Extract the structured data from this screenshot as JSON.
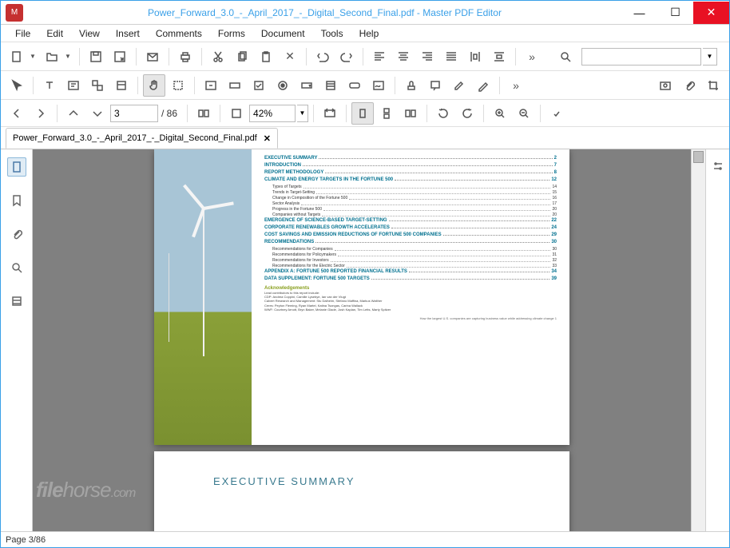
{
  "titlebar": {
    "title": "Power_Forward_3.0_-_April_2017_-_Digital_Second_Final.pdf - Master PDF Editor"
  },
  "menu": {
    "file": "File",
    "edit": "Edit",
    "view": "View",
    "insert": "Insert",
    "comments": "Comments",
    "forms": "Forms",
    "document": "Document",
    "tools": "Tools",
    "help": "Help"
  },
  "nav": {
    "current_page": "3",
    "total_pages": "/ 86",
    "zoom": "42%"
  },
  "tab": {
    "label": "Power_Forward_3.0_-_April_2017_-_Digital_Second_Final.pdf"
  },
  "search": {
    "placeholder": ""
  },
  "toc": [
    {
      "t": "h",
      "label": "EXECUTIVE SUMMARY",
      "pg": "2"
    },
    {
      "t": "h",
      "label": "INTRODUCTION",
      "pg": "7"
    },
    {
      "t": "h",
      "label": "REPORT METHODOLOGY",
      "pg": "8"
    },
    {
      "t": "h",
      "label": "CLIMATE AND ENERGY TARGETS IN THE FORTUNE 500",
      "pg": "12"
    },
    {
      "t": "s",
      "label": "Types of Targets",
      "pg": "14"
    },
    {
      "t": "s",
      "label": "Trends in Target-Setting",
      "pg": "15"
    },
    {
      "t": "s",
      "label": "Change in Composition of the Fortune 500",
      "pg": "16"
    },
    {
      "t": "s",
      "label": "Sector Analysis",
      "pg": "17"
    },
    {
      "t": "s",
      "label": "Progress in the Fortune 500",
      "pg": "20"
    },
    {
      "t": "s",
      "label": "Companies without Targets",
      "pg": "20"
    },
    {
      "t": "h",
      "label": "EMERGENCE OF SCIENCE-BASED TARGET-SETTING",
      "pg": "22"
    },
    {
      "t": "h",
      "label": "CORPORATE RENEWABLES GROWTH ACCELERATES",
      "pg": "24"
    },
    {
      "t": "h",
      "label": "COST SAVINGS AND EMISSION REDUCTIONS OF FORTUNE 500 COMPANIES",
      "pg": "29"
    },
    {
      "t": "h",
      "label": "RECOMMENDATIONS",
      "pg": "30"
    },
    {
      "t": "s",
      "label": "Recommendations for Companies",
      "pg": "30"
    },
    {
      "t": "s",
      "label": "Recommendations for Policymakers",
      "pg": "31"
    },
    {
      "t": "s",
      "label": "Recommendations for Investors",
      "pg": "32"
    },
    {
      "t": "s",
      "label": "Recommendations for the Electric Sector",
      "pg": "33"
    },
    {
      "t": "h",
      "label": "APPENDIX A: FORTUNE 500 REPORTED FINANCIAL RESULTS",
      "pg": "34"
    },
    {
      "t": "h",
      "label": "DATA SUPPLEMENT: FORTUNE 500 TARGETS",
      "pg": "39"
    }
  ],
  "ack": {
    "heading": "Acknowledgements",
    "lines": [
      "Lead contributors to this report include:",
      "CDP: Andrea Coppini, Camille Lysebye, Ian van der Vlugt",
      "Calvert Research and Management: Stu Dalheim, Stefano Maffina, Markus Walther",
      "Ceres: Peyton Fleming, Ryan Martel, Katina Tsongas, Carina Wallack",
      "WWF: Courtney Arnott, Bryn Baker, Melanie Glade, Josh Kaplan, Tim Letts, Marty Spitzer"
    ],
    "footer": "How the largest U.S. companies are capturing business value while addressing climate change  1"
  },
  "page2": {
    "heading": "EXECUTIVE SUMMARY"
  },
  "status": {
    "page": "Page 3/86"
  },
  "watermark": "filehorse.com",
  "more_glyph": "»"
}
